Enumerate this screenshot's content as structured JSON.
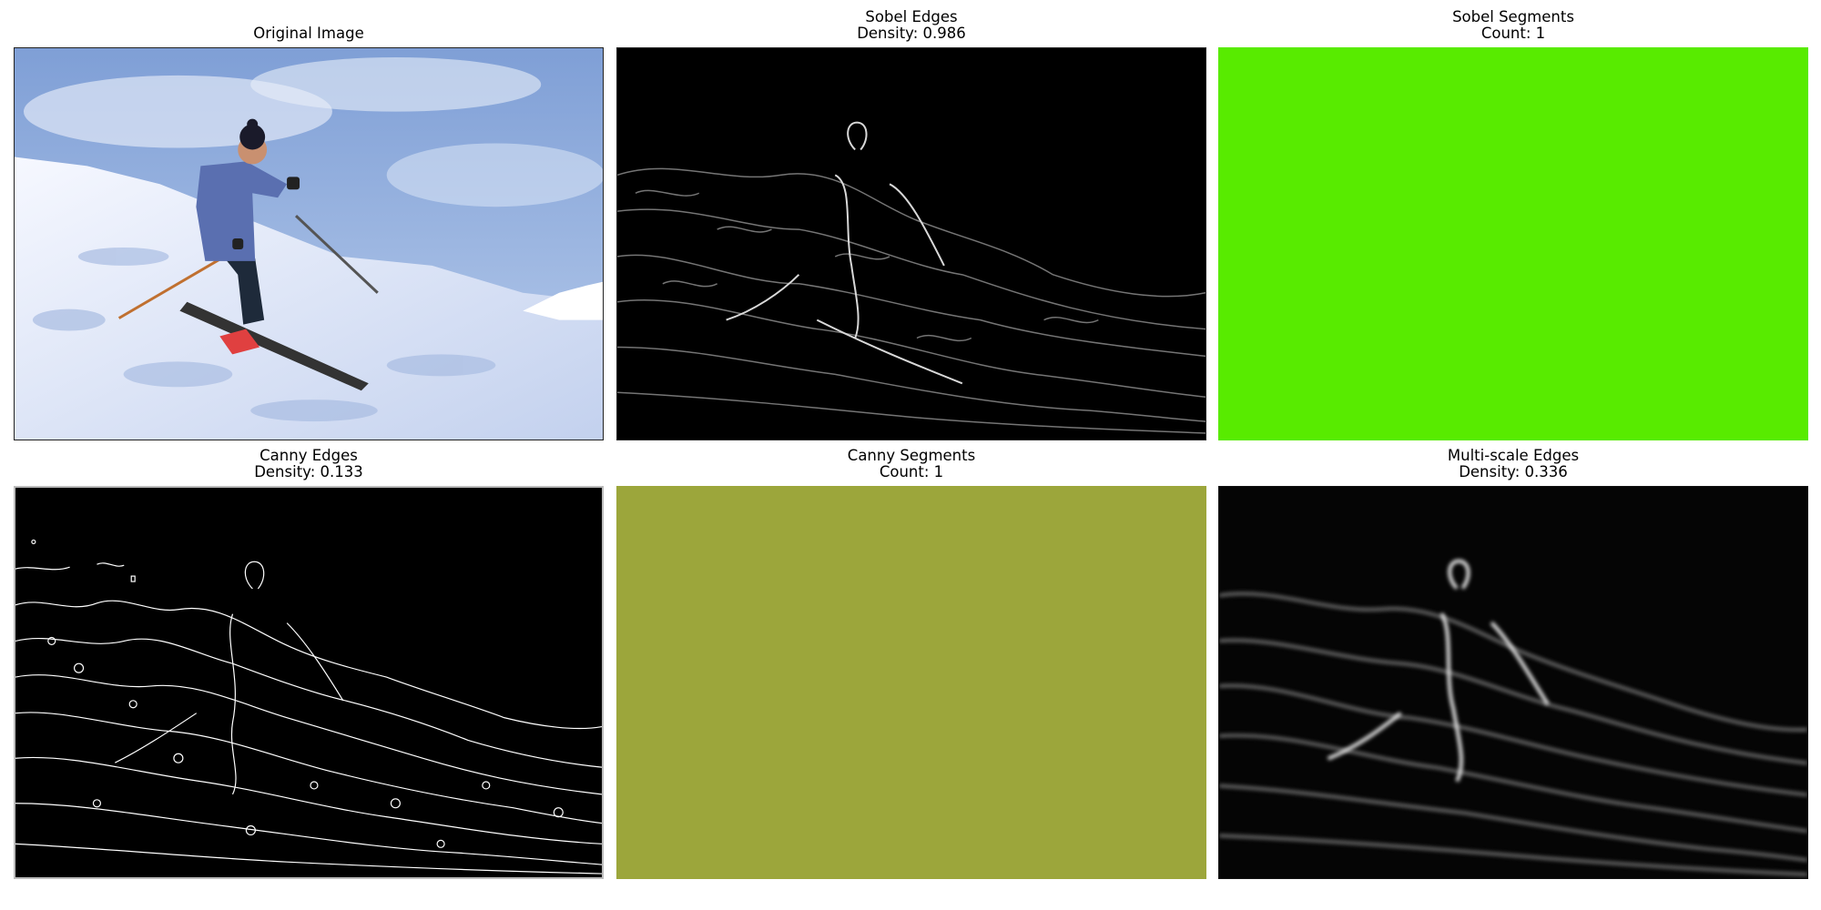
{
  "panels": [
    {
      "title": "Original Image"
    },
    {
      "title": "Sobel Edges",
      "subtitle": "Density: 0.986"
    },
    {
      "title": "Sobel Segments",
      "subtitle": "Count: 1"
    },
    {
      "title": "Canny Edges",
      "subtitle": "Density: 0.133"
    },
    {
      "title": "Canny Segments",
      "subtitle": "Count: 1"
    },
    {
      "title": "Multi-scale Edges",
      "subtitle": "Density: 0.336"
    }
  ],
  "colors": {
    "sobel_segment_fill": "#58eb00",
    "canny_segment_fill": "#9ca63b",
    "edge_background": "#000000",
    "sky": "#9bb4dc",
    "snow": "#eef2fb"
  }
}
